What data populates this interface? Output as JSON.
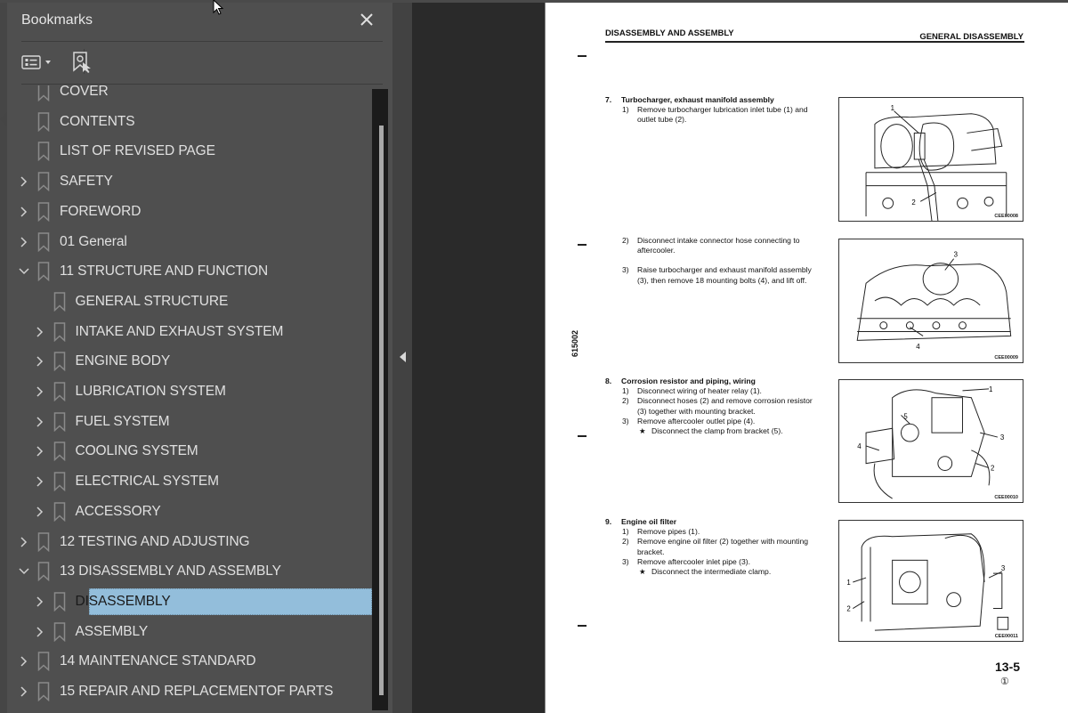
{
  "bookmarks_panel": {
    "title": "Bookmarks",
    "close_icon": "close-icon",
    "toolbar": {
      "options_icon": "list-options-icon",
      "dropdown_icon": "caret-down-icon",
      "find_current_icon": "find-current-bookmark-icon"
    },
    "items": [
      {
        "label": "COVER",
        "level": 0,
        "expander": "none"
      },
      {
        "label": "CONTENTS",
        "level": 0,
        "expander": "none"
      },
      {
        "label": "LIST OF REVISED PAGE",
        "level": 0,
        "expander": "none"
      },
      {
        "label": "SAFETY",
        "level": 0,
        "expander": "collapsed"
      },
      {
        "label": "FOREWORD",
        "level": 0,
        "expander": "collapsed"
      },
      {
        "label": "01 General",
        "level": 0,
        "expander": "collapsed"
      },
      {
        "label": "11 STRUCTURE AND FUNCTION",
        "level": 0,
        "expander": "expanded"
      },
      {
        "label": "GENERAL STRUCTURE",
        "level": 1,
        "expander": "none"
      },
      {
        "label": "INTAKE AND EXHAUST SYSTEM",
        "level": 1,
        "expander": "collapsed"
      },
      {
        "label": "ENGINE BODY",
        "level": 1,
        "expander": "collapsed"
      },
      {
        "label": "LUBRICATION SYSTEM",
        "level": 1,
        "expander": "collapsed"
      },
      {
        "label": "FUEL SYSTEM",
        "level": 1,
        "expander": "collapsed"
      },
      {
        "label": "COOLING SYSTEM",
        "level": 1,
        "expander": "collapsed"
      },
      {
        "label": "ELECTRICAL SYSTEM",
        "level": 1,
        "expander": "collapsed"
      },
      {
        "label": "ACCESSORY",
        "level": 1,
        "expander": "collapsed"
      },
      {
        "label": "12 TESTING AND ADJUSTING",
        "level": 0,
        "expander": "collapsed"
      },
      {
        "label": "13 DISASSEMBLY AND ASSEMBLY",
        "level": 0,
        "expander": "expanded"
      },
      {
        "label": "DISASSEMBLY",
        "level": 1,
        "expander": "collapsed",
        "selected": true
      },
      {
        "label": "ASSEMBLY",
        "level": 1,
        "expander": "collapsed"
      },
      {
        "label": "14 MAINTENANCE STANDARD",
        "level": 0,
        "expander": "collapsed"
      },
      {
        "label": "15 REPAIR AND REPLACEMENTOF PARTS",
        "level": 0,
        "expander": "collapsed"
      }
    ],
    "colors": {
      "selected_bg": "#93bedb",
      "panel_bg": "#4f4f4f",
      "text": "#e0e0e0"
    }
  },
  "document": {
    "header_left": "DISASSEMBLY AND ASSEMBLY",
    "header_right": "GENERAL DISASSEMBLY",
    "side_code": "615002",
    "page_number": "13-5",
    "revision_mark": "①",
    "sections": [
      {
        "num": "7.",
        "title": "Turbocharger, exhaust manifold assembly",
        "steps": [
          {
            "num": "1)",
            "text": "Remove turbocharger lubrication inlet tube (1) and outlet tube (2)."
          }
        ],
        "notes": []
      },
      {
        "num": "",
        "title": "",
        "steps": [
          {
            "num": "2)",
            "text": "Disconnect intake connector hose connecting to aftercooler."
          },
          {
            "num": "3)",
            "text": "Raise turbocharger and exhaust manifold assembly (3), then remove 18 mounting bolts (4), and lift off."
          }
        ],
        "notes": []
      },
      {
        "num": "8.",
        "title": "Corrosion resistor and piping, wiring",
        "steps": [
          {
            "num": "1)",
            "text": "Disconnect wiring of heater relay (1)."
          },
          {
            "num": "2)",
            "text": "Disconnect hoses (2) and remove corrosion resistor (3) together with mounting bracket."
          },
          {
            "num": "3)",
            "text": "Remove aftercooler outlet pipe (4)."
          }
        ],
        "notes": [
          "Disconnect the clamp from bracket (5)."
        ]
      },
      {
        "num": "9.",
        "title": "Engine oil filter",
        "steps": [
          {
            "num": "1)",
            "text": "Remove pipes (1)."
          },
          {
            "num": "2)",
            "text": "Remove engine oil filter (2) together with mounting bracket."
          },
          {
            "num": "3)",
            "text": "Remove aftercooler inlet pipe (3)."
          }
        ],
        "notes": [
          "Disconnect the intermediate clamp."
        ]
      }
    ],
    "figures": [
      {
        "code": "CEE00008",
        "callouts": [
          "1",
          "2"
        ]
      },
      {
        "code": "CEE00009",
        "callouts": [
          "3",
          "4"
        ]
      },
      {
        "code": "CEE00010",
        "callouts": [
          "1",
          "2",
          "3",
          "4",
          "5"
        ]
      },
      {
        "code": "CEE00011",
        "callouts": [
          "1",
          "2",
          "3"
        ]
      }
    ]
  }
}
